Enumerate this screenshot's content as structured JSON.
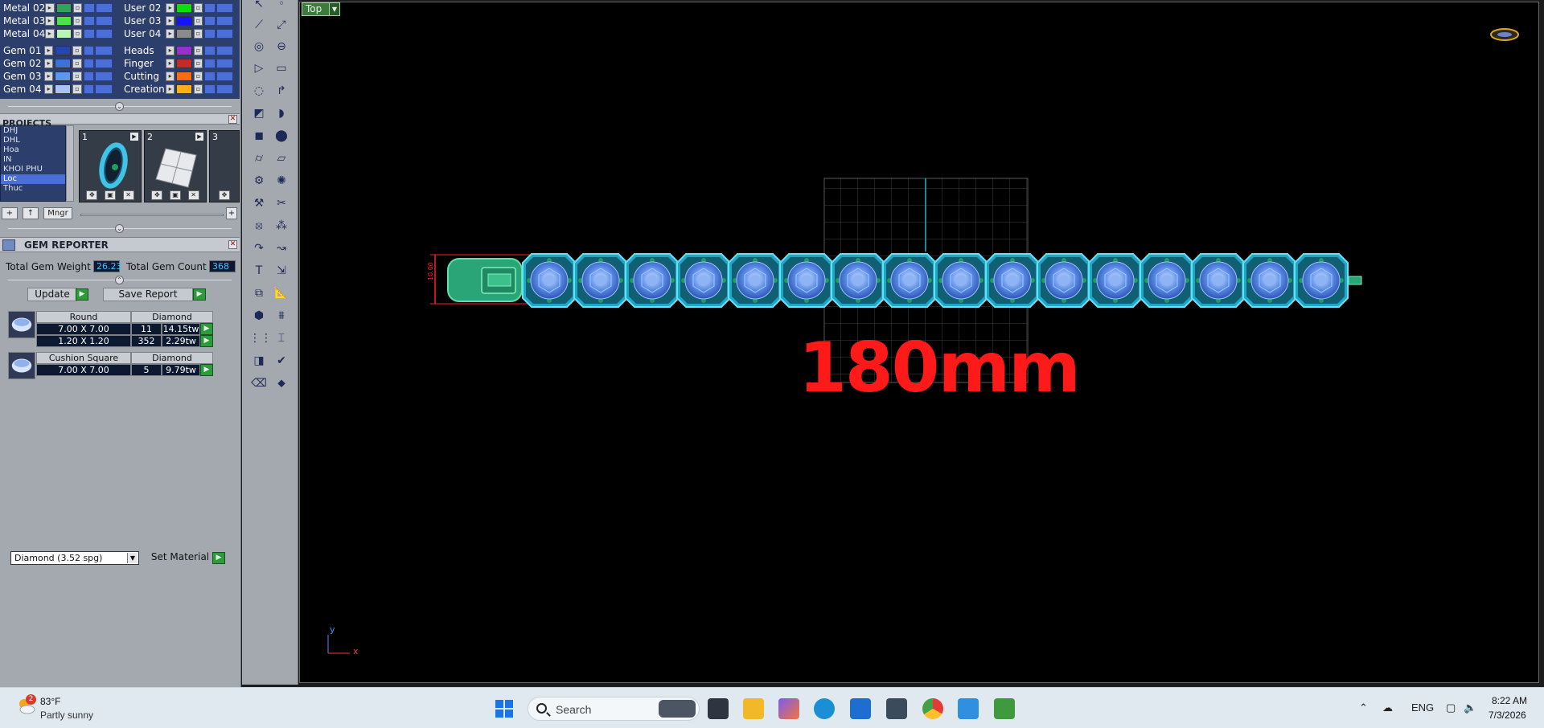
{
  "layers": {
    "col1": [
      "Metal 02",
      "Metal 03",
      "Metal 04",
      "Gem 01",
      "Gem 02",
      "Gem 03",
      "Gem 04"
    ],
    "col2": [
      "User 02",
      "User 03",
      "User 04",
      "Heads",
      "Finger",
      "Cutting",
      "Creation"
    ],
    "col1_colors": [
      "#2fa45a",
      "#46e646",
      "#b6f7b8",
      "#2347b0",
      "#3d70d8",
      "#5d96f0",
      "#a9c3f5"
    ],
    "col2_colors": [
      "#0ddf0d",
      "#1414ff",
      "#8a8a8a",
      "#9a2fcf",
      "#c42a2a",
      "#ff6a12",
      "#ffb012"
    ]
  },
  "projects": {
    "title": "PROJECTS",
    "list": [
      "DHJ",
      "DHL",
      "Hoa",
      "IN",
      "KHOI PHU",
      "Loc",
      "Thuc"
    ],
    "selected": "Loc",
    "thumbs": [
      "1",
      "2",
      "3"
    ],
    "manager_label": "Mngr"
  },
  "gem_reporter": {
    "title": "GEM REPORTER",
    "total_weight_label": "Total Gem Weight",
    "total_weight": "26.23",
    "total_count_label": "Total Gem Count",
    "total_count": "368",
    "update_label": "Update",
    "save_label": "Save Report",
    "groups": [
      {
        "shape": "Round",
        "material": "Diamond",
        "rows": [
          {
            "size": "7.00 X 7.00",
            "count": "11",
            "weight": "14.15tw"
          },
          {
            "size": "1.20 X 1.20",
            "count": "352",
            "weight": "2.29tw"
          }
        ]
      },
      {
        "shape": "Cushion Square",
        "material": "Diamond",
        "rows": [
          {
            "size": "7.00 X 7.00",
            "count": "5",
            "weight": "9.79tw"
          }
        ]
      }
    ],
    "material_select": "Diamond    (3.52 spg)",
    "set_material_label": "Set Material"
  },
  "viewport": {
    "view_name": "Top",
    "size_text": "180mm",
    "dim_text": "10.00",
    "axis_x": "x",
    "axis_y": "y"
  },
  "taskbar": {
    "weather_badge": "2",
    "temperature": "83°F",
    "condition": "Partly sunny",
    "search_placeholder": "Search",
    "language": "ENG",
    "time": "8:22 AM",
    "date": "7/3/2026"
  }
}
